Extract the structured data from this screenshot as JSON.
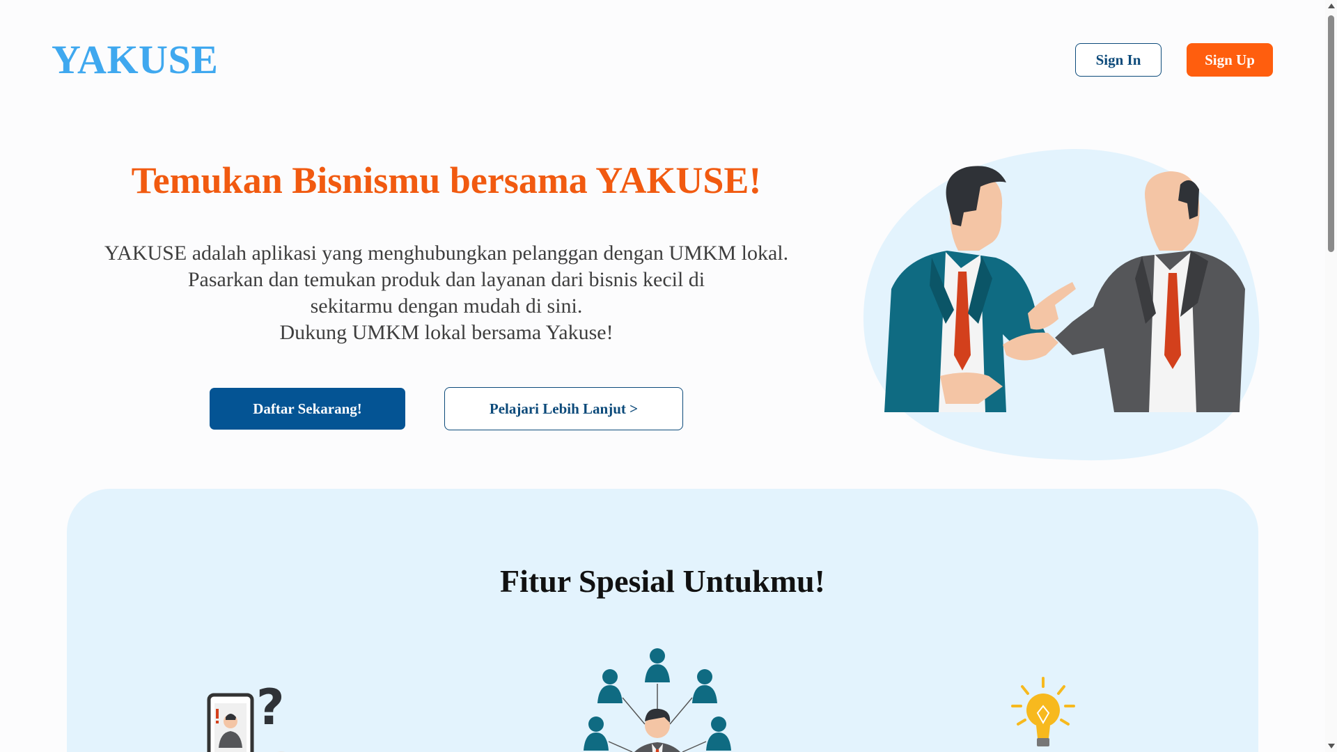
{
  "header": {
    "logo": "YAKUSE",
    "sign_in": "Sign In",
    "sign_up": "Sign Up"
  },
  "hero": {
    "title": "Temukan Bisnismu bersama YAKUSE!",
    "description_line1": "YAKUSE adalah aplikasi yang menghubungkan pelanggan dengan UMKM lokal.",
    "description_line2": "Pasarkan dan temukan produk dan layanan dari bisnis kecil di sekitarmu dengan mudah di sini.",
    "description_line3": "Dukung UMKM lokal bersama Yakuse!",
    "primary_button": "Daftar Sekarang!",
    "secondary_button": "Pelajari Lebih Lanjut >"
  },
  "features": {
    "title": "Fitur Spesial Untukmu!",
    "icons": [
      "phone-question-icon",
      "network-people-icon",
      "lightbulb-hand-icon"
    ]
  },
  "colors": {
    "brand_blue": "#3fa8ef",
    "accent_orange": "#ff5e0e",
    "navy": "#045494",
    "feature_bg": "#e3f3fd"
  }
}
